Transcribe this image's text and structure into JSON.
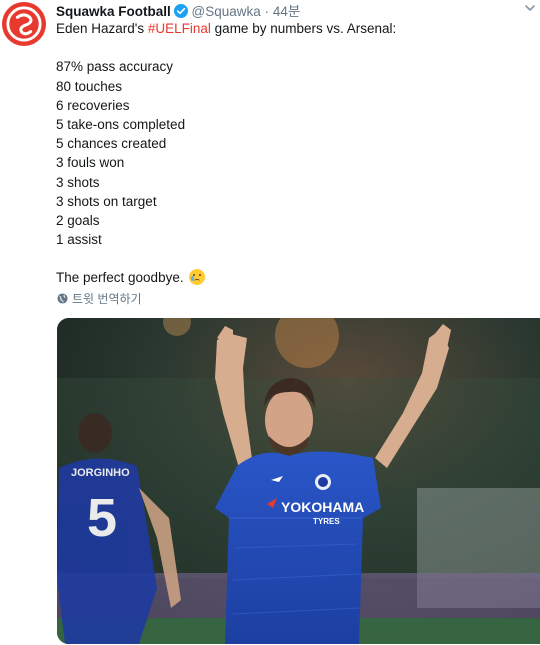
{
  "account": {
    "name": "Squawka Football",
    "handle": "@Squawka",
    "separator": "·",
    "time": "44분",
    "avatar_icon": "squawka-logo-icon",
    "brand_color": "#e8392f"
  },
  "tweet": {
    "intro_before": "Eden Hazard's ",
    "hashtag": "#UELFinal",
    "intro_after": " game by numbers vs. Arsenal:",
    "stats": [
      "87% pass accuracy",
      "80 touches",
      "6 recoveries",
      "5 take-ons completed",
      "5 chances created",
      "3 fouls won",
      "3 shots",
      "3 shots on target",
      "2 goals",
      "1 assist"
    ],
    "closing": "The perfect goodbye.",
    "emoji": "crying-face-emoji"
  },
  "translate": {
    "label": "트윗 번역하기",
    "icon": "globe-icon"
  },
  "photo": {
    "jersey_sponsor": "YOKOHAMA",
    "jersey_sponsor_sub": "TYRES",
    "back_number": "5",
    "back_name": "JORGINHO"
  }
}
